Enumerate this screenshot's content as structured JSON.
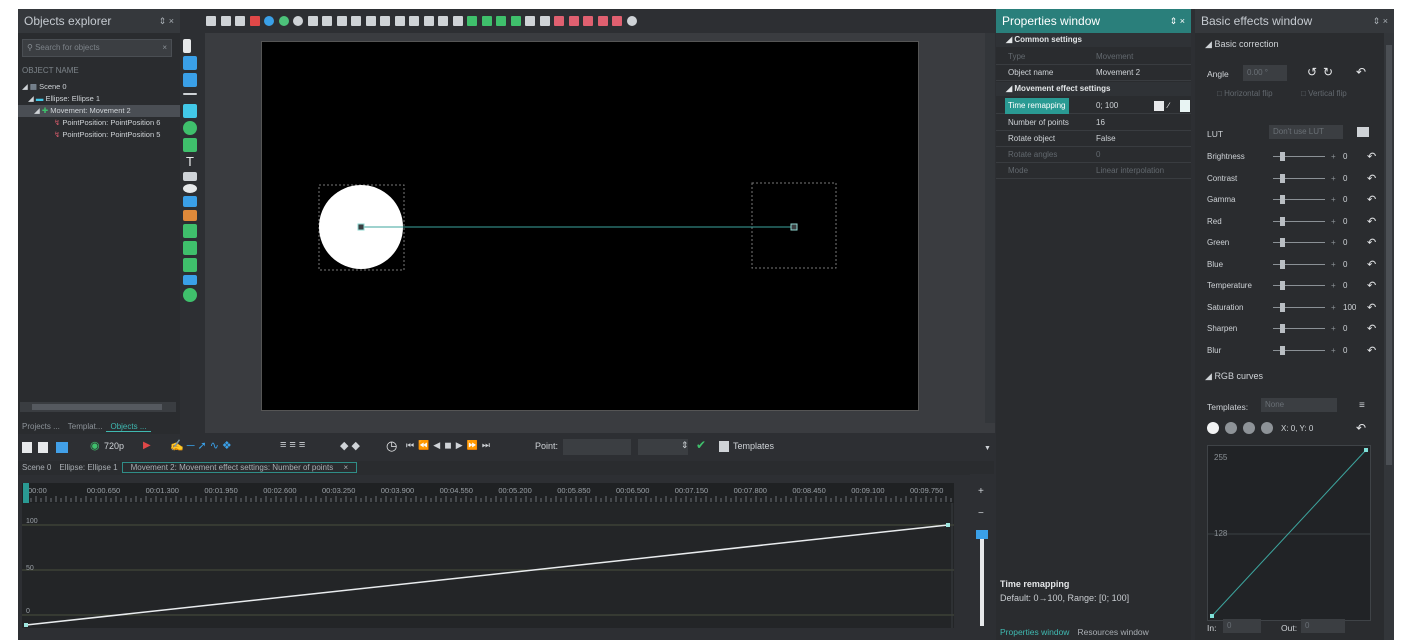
{
  "explorer": {
    "title": "Objects explorer",
    "pin": "↕ ×",
    "search_placeholder": "Search for objects",
    "column_header": "OBJECT NAME",
    "tree": [
      {
        "label": "Scene 0",
        "selected": false
      },
      {
        "label": "Ellipse: Ellipse 1",
        "selected": false
      },
      {
        "label": "Movement: Movement 2",
        "selected": true
      },
      {
        "label": "PointPosition: PointPosition 6",
        "selected": false
      },
      {
        "label": "PointPosition: PointPosition 5",
        "selected": false
      }
    ],
    "tabs": [
      "Projects ...",
      "Templat...",
      "Objects ..."
    ]
  },
  "timeline": {
    "resolution": "720p",
    "point_label": "Point:",
    "templates_label": "Templates",
    "tabs": [
      "Scene 0",
      "Ellipse: Ellipse 1",
      "Movement 2: Movement effect settings: Number of points"
    ],
    "ruler": [
      "00:00",
      "00:00.650",
      "00:01.300",
      "00:01.950",
      "00:02.600",
      "00:03.250",
      "00:03.900",
      "00:04.550",
      "00:05.200",
      "00:05.850",
      "00:06.500",
      "00:07.150",
      "00:07.800",
      "00:08.450",
      "00:09.100",
      "00:09.750"
    ],
    "y_labels": [
      "100",
      "50",
      "0"
    ],
    "curve_start": 0,
    "curve_end": 100
  },
  "properties": {
    "title": "Properties window",
    "groups": {
      "common": "Common settings",
      "movement": "Movement effect settings"
    },
    "rows": {
      "type": {
        "key": "Type",
        "value": "Movement"
      },
      "name": {
        "key": "Object name",
        "value": "Movement 2"
      },
      "time": {
        "key": "Time remapping",
        "value": "0; 100"
      },
      "points": {
        "key": "Number of points",
        "value": "16"
      },
      "rotate": {
        "key": "Rotate object",
        "value": "False"
      },
      "angles": {
        "key": "Rotate angles",
        "value": "0"
      },
      "mode": {
        "key": "Mode",
        "value": "Linear interpolation"
      }
    },
    "desc_title": "Time remapping",
    "desc_text": "Default: 0→100, Range: [0; 100]",
    "tabs": [
      "Properties window",
      "Resources window"
    ]
  },
  "effects": {
    "title": "Basic effects window",
    "basic_header": "Basic correction",
    "angle_label": "Angle",
    "angle_value": "0.00 °",
    "hflip": "Horizontal flip",
    "vflip": "Vertical flip",
    "lut_label": "LUT",
    "lut_value": "Don't use LUT",
    "sliders": [
      {
        "name": "Brightness",
        "value": "0"
      },
      {
        "name": "Contrast",
        "value": "0"
      },
      {
        "name": "Gamma",
        "value": "0"
      },
      {
        "name": "Red",
        "value": "0"
      },
      {
        "name": "Green",
        "value": "0"
      },
      {
        "name": "Blue",
        "value": "0"
      },
      {
        "name": "Temperature",
        "value": "0"
      },
      {
        "name": "Saturation",
        "value": "100"
      },
      {
        "name": "Sharpen",
        "value": "0"
      },
      {
        "name": "Blur",
        "value": "0"
      }
    ],
    "rgb_header": "RGB curves",
    "templates_label": "Templates:",
    "templates_value": "None",
    "xy": "X: 0, Y: 0",
    "curve_top": "255",
    "curve_mid": "128",
    "in_label": "In:",
    "in_value": "0",
    "out_label": "Out:",
    "out_value": "0"
  },
  "colors": {
    "accent": "#2a9a93",
    "canvas": "#000000",
    "ellipse": "#ffffff"
  }
}
